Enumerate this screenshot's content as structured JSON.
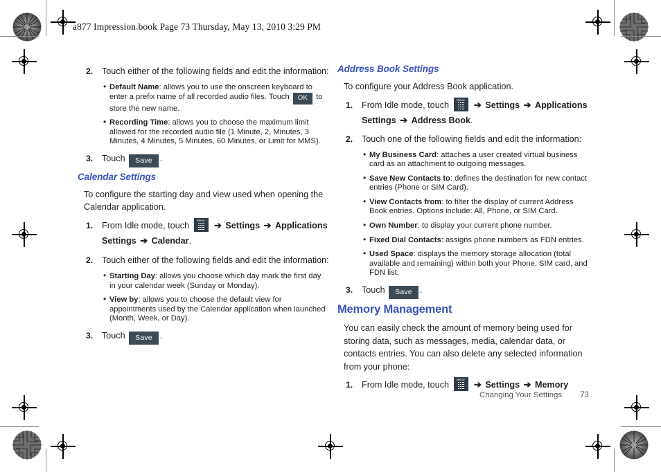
{
  "page": {
    "book_header": "a877 Impression.book  Page 73  Thursday, May 13, 2010  3:29 PM",
    "footer_chapter": "Changing Your Settings",
    "footer_page_number": "73",
    "accent_color": "#3A53B8",
    "chip_color": "#3C4A56",
    "text_color": "#231F20"
  },
  "left_column": {
    "step2": {
      "num": "2.",
      "text": "Touch either of the following fields and edit the information:"
    },
    "bullets": [
      {
        "term": "Default Name",
        "text_before": ": allows you to use the onscreen keyboard to enter a prefix name of all recorded audio files. Touch ",
        "chip": "OK",
        "text_after": " to store the new name."
      },
      {
        "term": "Recording Time",
        "text_before": ": allows you to choose the maximum limit allowed for the recorded audio file (1 Minute, 2, Minutes, 3 Minutes, 4 Minutes, 5 Minutes, 60 Minutes, or Limit for MMS).",
        "chip": "",
        "text_after": ""
      }
    ],
    "step3": {
      "num": "3.",
      "label": "Touch",
      "chip": "Save",
      "period": "."
    },
    "calendar_section": {
      "heading": "Calendar Settings",
      "intro": "To configure the starting day and view used when opening the Calendar application.",
      "step1": {
        "num": "1.",
        "prefix": "From Idle mode, touch",
        "icon_label": "Menu",
        "arrow": "➔",
        "path1": "Settings",
        "path2": "Applications Settings",
        "path3": "Calendar",
        "period": "."
      },
      "step2": {
        "num": "2.",
        "text": "Touch either of the following fields and edit the information:"
      },
      "bullets": [
        {
          "term": "Starting Day",
          "text": ": allows you choose which day mark the first day in your calendar week (Sunday or Monday)."
        },
        {
          "term": "View by",
          "text": ": allows you to choose the default view for appointments used by the Calendar application when launched (Month, Week, or Day)."
        }
      ],
      "step3": {
        "num": "3.",
        "label": "Touch",
        "chip": "Save",
        "period": "."
      }
    }
  },
  "right_column": {
    "address_book_section": {
      "heading": "Address Book Settings",
      "intro": "To configure your Address Book application.",
      "step1": {
        "num": "1.",
        "prefix": "From Idle mode, touch",
        "icon_label": "Menu",
        "arrow": "➔",
        "path1": "Settings",
        "path2": "Applications Settings",
        "path3": "Address Book",
        "period": "."
      },
      "step2": {
        "num": "2.",
        "text": "Touch one of the following fields and edit the information:"
      },
      "bullets": [
        {
          "term": "My Business Card",
          "text": ": attaches a user created virtual business card as an attachment to outgoing messages."
        },
        {
          "term": "Save New Contacts to",
          "text": ": defines the destination for new contact entries (Phone or SIM Card)."
        },
        {
          "term": "View Contacts from",
          "text": ": to filter the display of current Address Book entries. Options include: All, Phone, or SIM Card."
        },
        {
          "term": "Own Number",
          "text": ": to display your current phone number."
        },
        {
          "term": "Fixed Dial Contacts",
          "text": ": assigns phone numbers as FDN entries."
        },
        {
          "term": "Used Space",
          "text": ": displays the memory storage allocation (total available and remaining) within both your Phone, SIM card, and FDN list."
        }
      ],
      "step3": {
        "num": "3.",
        "label": "Touch",
        "chip": "Save",
        "period": "."
      }
    },
    "memory_section": {
      "heading": "Memory Management",
      "intro": "You can easily check the amount of memory being used for storing data, such as messages, media, calendar data, or contacts entries. You can also delete any selected information from your phone:",
      "step1": {
        "num": "1.",
        "prefix": "From Idle mode, touch",
        "icon_label": "Menu",
        "arrow": "➔",
        "path1": "Settings",
        "path2": "Memory"
      }
    }
  }
}
